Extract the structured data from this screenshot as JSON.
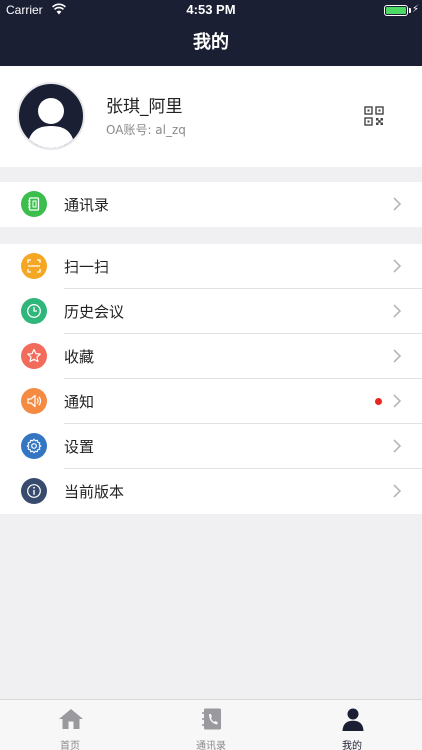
{
  "status_bar": {
    "carrier": "Carrier",
    "time": "4:53 PM"
  },
  "header": {
    "title": "我的"
  },
  "profile": {
    "name": "张琪_阿里",
    "account": "OA账号: al_zq"
  },
  "contacts_section": [
    {
      "label": "通讯录",
      "icon": "contacts-icon",
      "color": "#3bbf4c"
    }
  ],
  "menu": [
    {
      "label": "扫一扫",
      "icon": "scan-icon",
      "color": "#f5a623"
    },
    {
      "label": "历史会议",
      "icon": "clock-icon",
      "color": "#2fb67a"
    },
    {
      "label": "收藏",
      "icon": "star-icon",
      "color": "#f26b5b"
    },
    {
      "label": "通知",
      "icon": "speaker-icon",
      "color": "#f58a42"
    },
    {
      "label": "设置",
      "icon": "gear-icon",
      "color": "#3576c4"
    },
    {
      "label": "当前版本",
      "icon": "info-icon",
      "color": "#384a6e"
    }
  ],
  "tabs": [
    {
      "label": "首页",
      "icon": "home-icon"
    },
    {
      "label": "通讯录",
      "icon": "phonebook-icon"
    },
    {
      "label": "我的",
      "icon": "person-icon",
      "active": true
    }
  ],
  "colors": {
    "navy": "#1b1f33",
    "badge": "#e8251f"
  }
}
